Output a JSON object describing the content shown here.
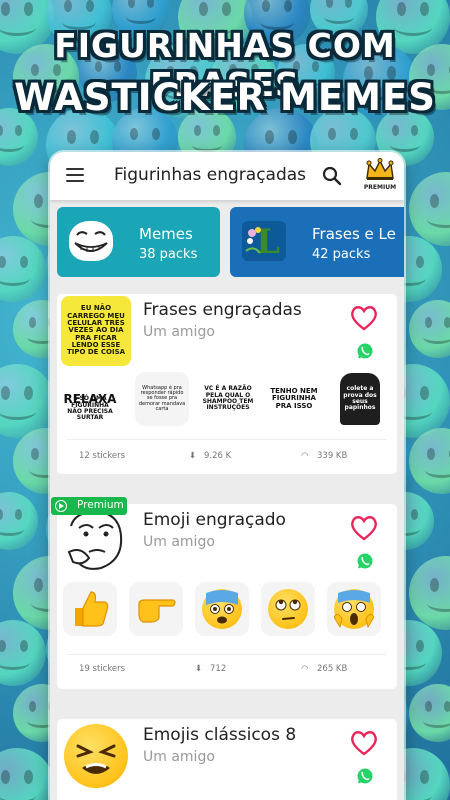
{
  "headline": {
    "line1": "FIGURINHAS COM FRASES",
    "line2": "WASTICKER MEMES"
  },
  "appbar": {
    "title": "Figurinhas engraçadas",
    "premium_label": "PREMIUM",
    "menu_icon": "menu-icon",
    "search_icon": "search-icon",
    "crown_icon": "crown-icon"
  },
  "categories": [
    {
      "name": "Memes",
      "count": "38 packs",
      "color": "#1aa6b7"
    },
    {
      "name": "Frases e Le",
      "count": "42 packs",
      "color": "#1b6fb8"
    }
  ],
  "packs": [
    {
      "name": "Frases engraçadas",
      "author": "Um amigo",
      "premium": false,
      "cover_text": "EU NÃO CARREGO MEU CELULAR TRÊS VEZES AO DIA PRA FICAR LENDO ESSE TIPO DE COISA",
      "stickers": [
        "RELAXA",
        "É SÓ UMA FIGURINHA NÃO PRECISA SURTAR",
        "Whatsapp é pra responder rápido se fosse pra demorar mandava carta",
        "VC É A RAZÃO PELA QUAL O SHAMPOO TEM INSTRUÇÕES",
        "TENHO NEM FIGURINHA PRA ISSO",
        "colete a prova dos seus papinhos"
      ],
      "count": "12 stickers",
      "downloads": "9.26 K",
      "size": "339 KB"
    },
    {
      "name": "Emoji engraçado",
      "author": "Um amigo",
      "premium": true,
      "premium_label": "Premium",
      "stickers": [
        "thumbs-up",
        "pointing-right",
        "scared-face",
        "eyes-up-face",
        "screaming-face"
      ],
      "count": "19 stickers",
      "downloads": "712",
      "size": "265 KB"
    },
    {
      "name": "Emojis clássicos 8",
      "author": "Um amigo",
      "premium": false,
      "cover_icon": "tired-face"
    }
  ],
  "colors": {
    "heart": "#e8265a",
    "whatsapp": "#25d366",
    "premium_badge": "#18b84c",
    "memes_card": "#1aa6b7",
    "frases_card": "#1b6fb8"
  }
}
